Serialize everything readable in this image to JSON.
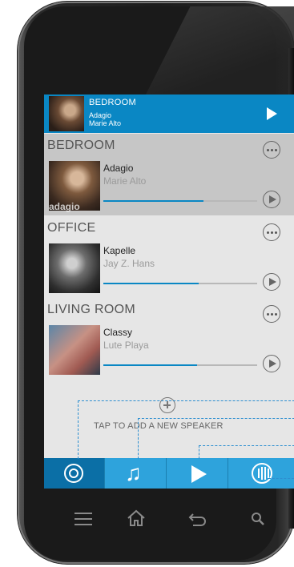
{
  "now_playing": {
    "room": "BEDROOM",
    "track": "Adagio",
    "artist": "Marie Alto"
  },
  "speakers": [
    {
      "room": "BEDROOM",
      "track": "Adagio",
      "artist": "Marie Alto",
      "art_text": "adagio",
      "progress": 0.65
    },
    {
      "room": "OFFICE",
      "track": "Kapelle",
      "artist": "Jay Z. Hans",
      "progress": 0.62
    },
    {
      "room": "LIVING ROOM",
      "track": "Classy",
      "artist": "Lute Playa",
      "progress": 0.61
    }
  ],
  "add_speaker": {
    "label": "TAP TO ADD A NEW SPEAKER"
  },
  "tabs": [
    {
      "icon": "speaker-icon",
      "active": true
    },
    {
      "icon": "music-note-icon",
      "active": false
    },
    {
      "icon": "play-icon",
      "active": false
    },
    {
      "icon": "sound-wave-icon",
      "active": false
    }
  ],
  "hardware_nav": [
    "menu-icon",
    "home-icon",
    "back-icon",
    "search-icon"
  ],
  "colors": {
    "accent": "#0a87c4",
    "tabbar": "#2ea3dc",
    "selected_row": "#c6c6c6"
  }
}
